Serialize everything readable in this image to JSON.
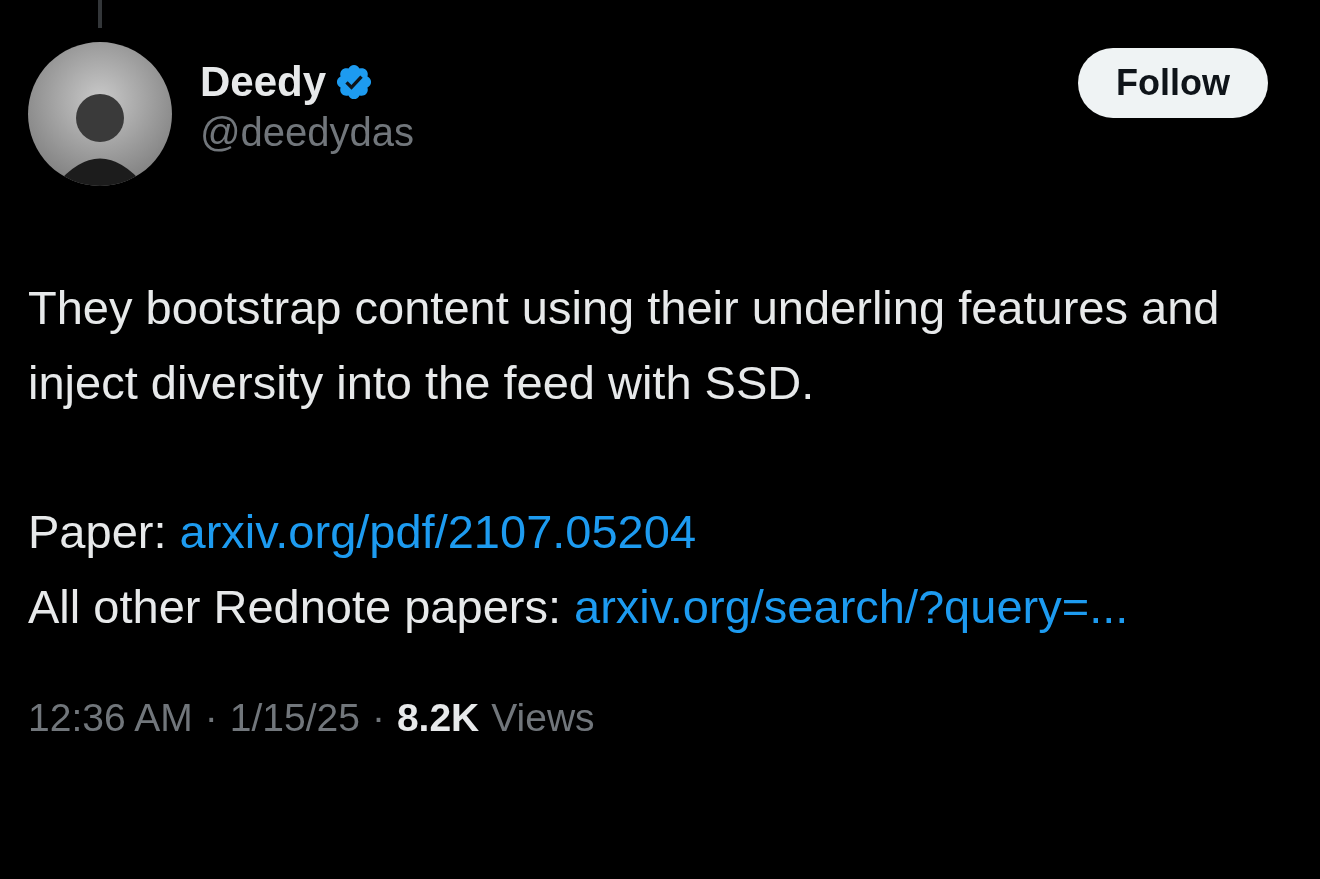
{
  "tweet": {
    "author": {
      "name": "Deedy",
      "verified": true,
      "handle": "@deedydas"
    },
    "follow_button": "Follow",
    "paragraphs": [
      {
        "lines": [
          [
            {
              "kind": "plain",
              "text": "They bootstrap content using their underling features and inject diversity into the feed with SSD."
            }
          ]
        ]
      },
      {
        "lines": [
          [
            {
              "kind": "plain",
              "text": "Paper: "
            },
            {
              "kind": "link",
              "text": "arxiv.org/pdf/2107.05204"
            }
          ],
          [
            {
              "kind": "plain",
              "text": "All other Rednote papers: "
            },
            {
              "kind": "link",
              "text": "arxiv.org/search/?query=..."
            }
          ]
        ]
      }
    ],
    "footer": {
      "time": "12:36 AM",
      "separator": "·",
      "date": "1/15/25",
      "views_count": "8.2K",
      "views_label": "Views"
    }
  }
}
